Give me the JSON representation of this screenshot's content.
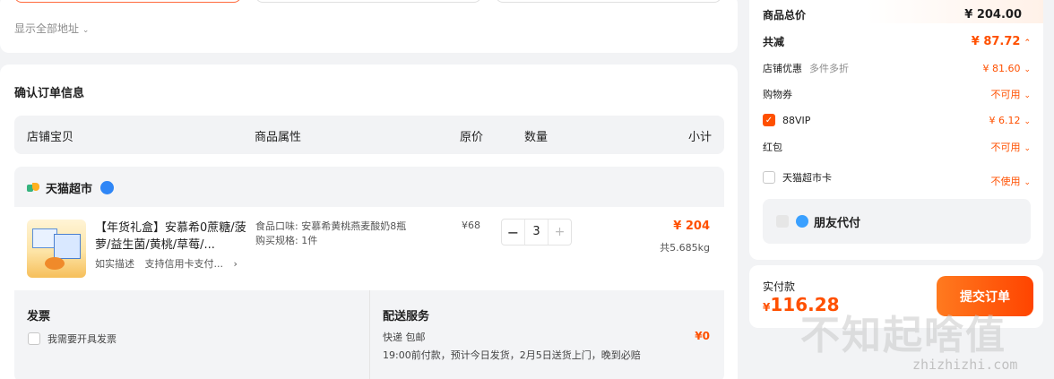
{
  "address": {
    "show_all": "显示全部地址",
    "chevron": "⌄"
  },
  "order": {
    "title": "确认订单信息",
    "headers": {
      "item": "店铺宝贝",
      "attr": "商品属性",
      "price": "原价",
      "qty": "数量",
      "subtotal": "小计"
    },
    "shop": {
      "name": "天猫超市",
      "item": {
        "title": "【年货礼盒】安慕希0蔗糖/菠萝/益生菌/黄桃/草莓/...",
        "tag1": "如实描述",
        "tag2": "支持信用卡支付...",
        "tag_arrow": "›",
        "attr1": "食品口味: 安慕希黄桃燕麦酸奶8瓶",
        "attr2": "购买规格: 1件",
        "price": "¥68",
        "qty": "3",
        "minus": "−",
        "plus": "+",
        "subtotal": "¥ 204",
        "weight": "共5.685kg"
      },
      "invoice": {
        "title": "发票",
        "option": "我需要开具发票"
      },
      "delivery": {
        "title": "配送服务",
        "line1": "快递 包邮",
        "line2": "19:00前付款，预计今日发货，2月5日送货上门，晚到必赔",
        "fee": "¥0"
      }
    }
  },
  "summary": {
    "total_label": "商品总价",
    "total_value": "¥ 204.00",
    "discount_label": "共减",
    "discount_value": "¥ 87.72",
    "shop_promo_label": "店铺优惠",
    "shop_promo_note": "多件多折",
    "shop_promo_value": "¥ 81.60",
    "voucher_label": "购物券",
    "voucher_value": "不可用",
    "vip_label": "88VIP",
    "vip_value": "¥ 6.12",
    "redpack_label": "红包",
    "redpack_value": "不可用",
    "card_label": "天猫超市卡",
    "card_value": "不使用",
    "friend_pay": "朋友代付",
    "up_chevron": "⌃",
    "down_chevron": "⌄"
  },
  "payment": {
    "label": "实付款",
    "currency": "¥",
    "amount": "116.28",
    "submit": "提交订单"
  },
  "watermark": {
    "text": "不知起啥值",
    "url": "zhizhizhi.com"
  },
  "colors": {
    "accent": "#ff5000",
    "bg": "#f2f3f5"
  }
}
